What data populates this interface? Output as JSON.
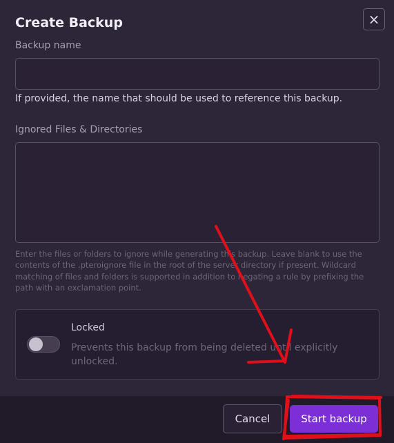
{
  "modal": {
    "title": "Create Backup",
    "close_icon": "×"
  },
  "backup_name": {
    "label": "Backup name",
    "value": "",
    "placeholder": "",
    "help": "If provided, the name that should be used to reference this backup."
  },
  "ignored": {
    "label": "Ignored Files & Directories",
    "value": "",
    "help": "Enter the files or folders to ignore while generating this backup. Leave blank to use the contents of the .pteroignore file in the root of the server directory if present. Wildcard matching of files and folders is supported in addition to negating a rule by prefixing the path with an exclamation point."
  },
  "locked": {
    "title": "Locked",
    "description": "Prevents this backup from being deleted until explicitly unlocked.",
    "enabled": false
  },
  "footer": {
    "cancel_label": "Cancel",
    "start_label": "Start backup"
  },
  "colors": {
    "accent": "#7c2fd6",
    "annotation": "#e0101a"
  },
  "icons": {
    "close": "close-icon",
    "annotation_arrow": "arrow-annotation",
    "annotation_box": "highlight-box-annotation"
  }
}
